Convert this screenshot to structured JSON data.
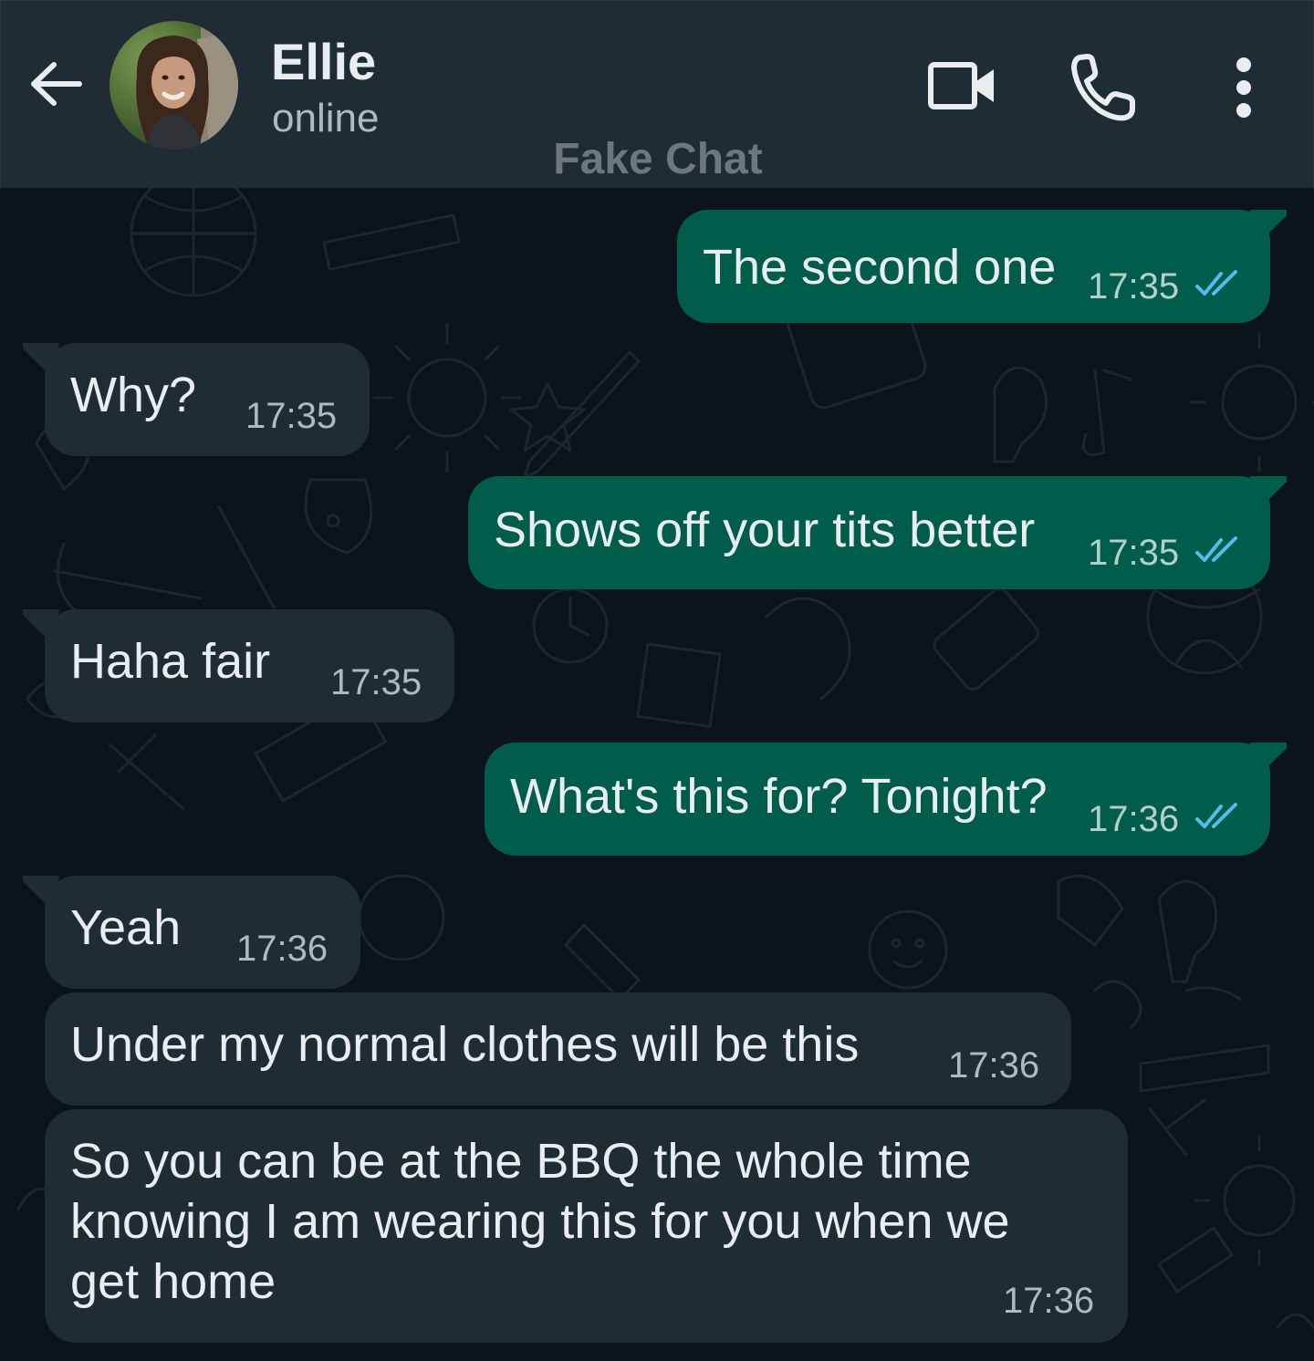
{
  "header": {
    "contact_name": "Ellie",
    "contact_status": "online",
    "watermark": "Fake Chat",
    "icons": {
      "back": "arrow-left-icon",
      "video": "video-camera-icon",
      "call": "phone-icon",
      "menu": "more-vertical-icon"
    }
  },
  "colors": {
    "header_bg": "#1f2c34",
    "chat_bg": "#0b141a",
    "outgoing_bubble": "#005c4b",
    "incoming_bubble": "#1f2c34",
    "read_ticks": "#53bdeb",
    "text": "#e9edef"
  },
  "messages": [
    {
      "direction": "out",
      "text": "The second one",
      "time": "17:35",
      "status": "read"
    },
    {
      "direction": "in",
      "text": "Why?",
      "time": "17:35"
    },
    {
      "direction": "out",
      "text": "Shows off your tits better",
      "time": "17:35",
      "status": "read"
    },
    {
      "direction": "in",
      "text": "Haha fair",
      "time": "17:35"
    },
    {
      "direction": "out",
      "text": "What's this for? Tonight?",
      "time": "17:36",
      "status": "read"
    },
    {
      "direction": "in",
      "text": "Yeah",
      "time": "17:36"
    },
    {
      "direction": "in",
      "text": "Under my normal clothes will be this",
      "time": "17:36"
    },
    {
      "direction": "in",
      "lines": [
        "So you can be at the BBQ the whole time",
        "knowing I am wearing this for you when we",
        "get home"
      ],
      "time": "17:36"
    }
  ]
}
